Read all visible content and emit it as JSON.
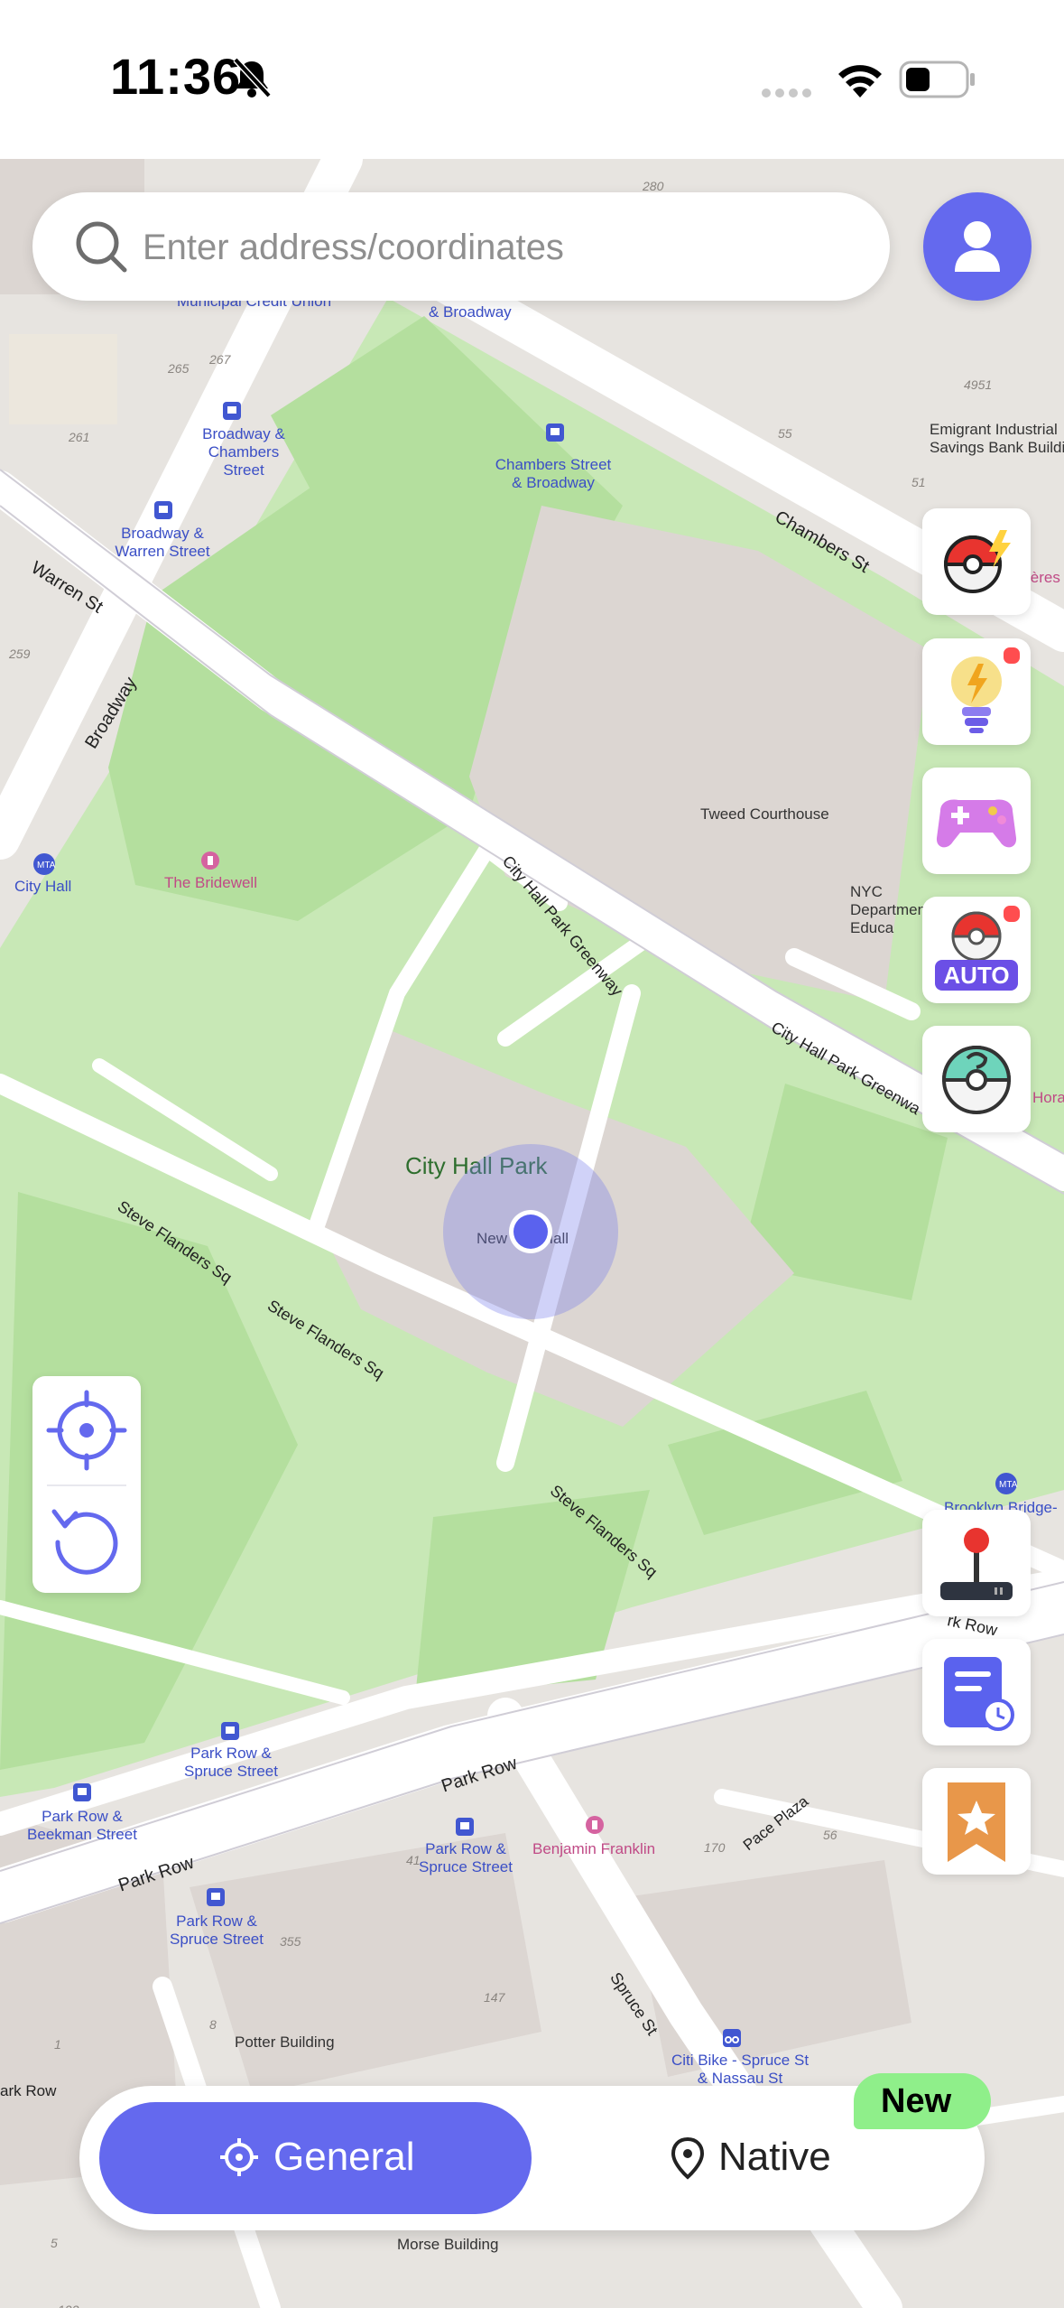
{
  "status_bar": {
    "time": "11:36"
  },
  "search": {
    "placeholder": "Enter address/coordinates"
  },
  "map": {
    "labels": {
      "city_hall_park": "City Hall Park",
      "new_city_hall": "New City Hall",
      "tweed_courthouse": "Tweed Courthouse",
      "nyc_department": "NYC Department of Educa",
      "the_bridewell": "The Bridewell",
      "city_hall_station": "City Hall",
      "broadway_warren": "Broadway & Warren Street",
      "broadway_chambers": "Broadway & Chambers Street",
      "chambers_broadway": "Chambers Street & Broadway",
      "and_broadway": "& Broadway",
      "municipal_credit_union": "Municipal Credit Union",
      "emigrant_bank": "Emigrant Industrial Savings Bank Buildi",
      "brooklyn_bridge": "Brooklyn Bridge-",
      "park_row_spruce_1": "Park Row & Spruce Street",
      "park_row_beekman": "Park Row & Beekman Street",
      "park_row_spruce_2": "Park Row & Spruce Street",
      "park_row_spruce_3": "Park Row & Spruce Street",
      "benjamin_franklin": "Benjamin Franklin",
      "potter_building": "Potter Building",
      "citi_bike": "Citi Bike - Spruce St & Nassau St",
      "morse_building": "Morse Building",
      "hora": "Hora",
      "ieres": "ières"
    },
    "streets": {
      "warren_st": "Warren St",
      "broadway": "Broadway",
      "chambers_st": "Chambers St",
      "city_hall_park_greenway_1": "City Hall Park Greenway",
      "city_hall_park_greenway_2": "City Hall Park Greenwa",
      "steve_flanders_1": "Steve Flanders Sq",
      "steve_flanders_2": "Steve Flanders Sq",
      "steve_flanders_3": "Steve Flanders Sq",
      "park_row_1": "Park Row",
      "park_row_2": "Park Row",
      "park_row_3": "ark Row",
      "park_row_4": "rk Row",
      "pace_plaza": "Pace Plaza",
      "spruce_st": "Spruce St"
    },
    "numbers": [
      "280",
      "265",
      "267",
      "261",
      "259",
      "4951",
      "55",
      "51",
      "56",
      "170",
      "147",
      "355",
      "41",
      "1",
      "8",
      "5",
      "123"
    ]
  },
  "side_tools": [
    {
      "name": "pokeball-flash",
      "badge": false
    },
    {
      "name": "tips-bulb",
      "badge": true
    },
    {
      "name": "gamepad",
      "badge": false
    },
    {
      "name": "auto-catch",
      "badge": true,
      "label": "AUTO"
    },
    {
      "name": "mystery-ball",
      "badge": false
    }
  ],
  "lower_tools": [
    "joystick",
    "history-route",
    "favorites"
  ],
  "bottom_bar": {
    "general_label": "General",
    "native_label": "Native",
    "new_badge": "New"
  },
  "colors": {
    "accent": "#6469EE",
    "badge_green": "#8FEF8A",
    "notification_red": "#FF4D4F",
    "park_green": "#B9E3A7"
  }
}
